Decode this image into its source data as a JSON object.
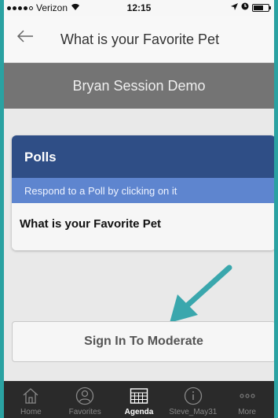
{
  "status_bar": {
    "carrier": "Verizon",
    "time": "12:15"
  },
  "navbar": {
    "back_icon": "back-arrow-icon",
    "title": "What is your Favorite Pet"
  },
  "session": {
    "title": "Bryan Session Demo"
  },
  "polls": {
    "header": "Polls",
    "subheader": "Respond to a Poll by clicking on it",
    "items": [
      "What is your Favorite Pet"
    ]
  },
  "sign_in_button": "Sign In To Moderate",
  "tabbar": {
    "tabs": [
      {
        "label": "Home",
        "icon": "home-icon"
      },
      {
        "label": "Favorites",
        "icon": "person-icon"
      },
      {
        "label": "Agenda",
        "icon": "calendar-icon",
        "active": true
      },
      {
        "label": "Steve_May31",
        "icon": "info-icon"
      },
      {
        "label": "More",
        "icon": "more-icon"
      }
    ]
  },
  "colors": {
    "frame": "#2aa2a2",
    "poll_header": "#2f4e86",
    "poll_subheader": "#5e85cf",
    "arrow": "#3aa7ad"
  }
}
